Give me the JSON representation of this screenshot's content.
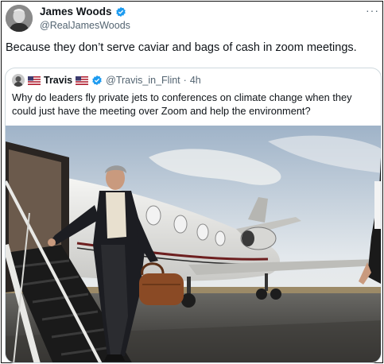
{
  "tweet": {
    "author_name": "James Woods",
    "author_handle": "@RealJamesWoods",
    "text": "Because they don’t serve caviar and bags of cash in zoom meetings.",
    "more_label": "···"
  },
  "quoted": {
    "author_name": "Travis",
    "author_handle": "@Travis_in_Flint",
    "separator": "·",
    "time": "4h",
    "text": "Why do leaders fly private jets to conferences on climate change when they could just have the meeting over Zoom and help the environment?"
  },
  "colors": {
    "verified": "#1d9bf0",
    "secondary_text": "#536471",
    "border": "#cfd9de"
  },
  "icons": [
    "verified-badge-icon",
    "more-options-icon",
    "us-flag-icon"
  ]
}
